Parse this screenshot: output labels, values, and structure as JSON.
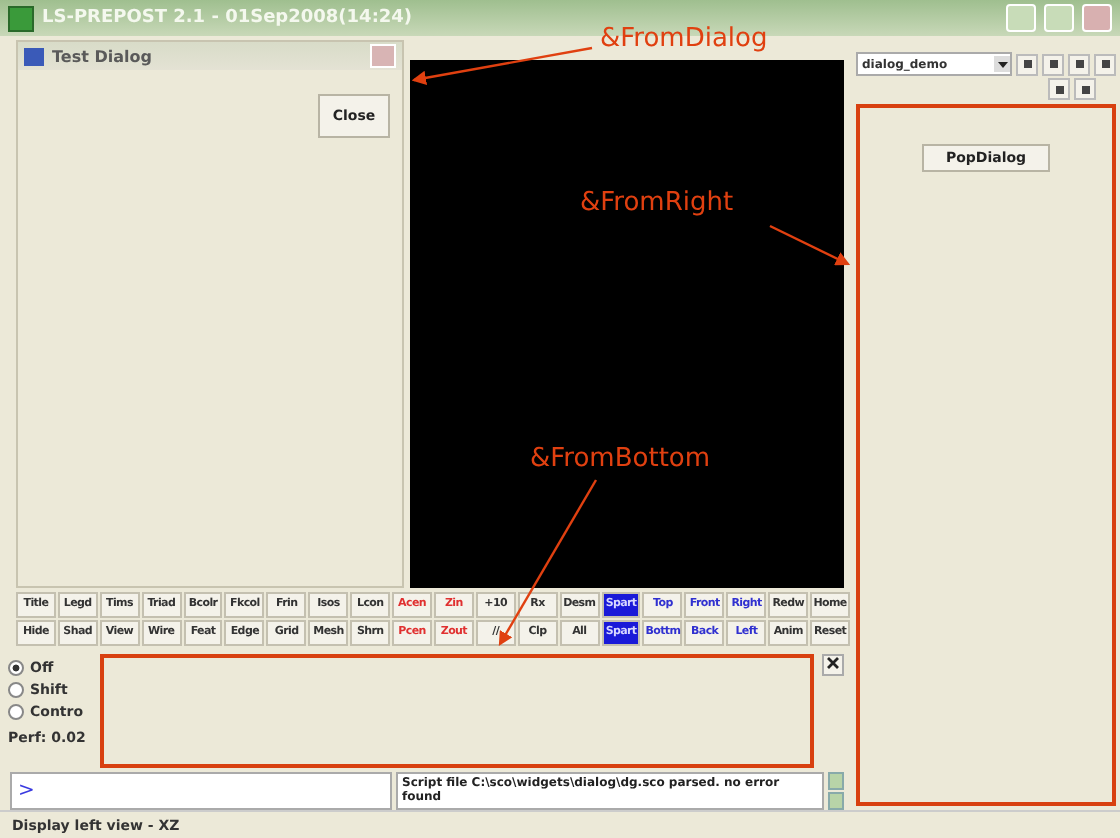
{
  "window": {
    "title": "LS-PREPOST 2.1 - 01Sep2008(14:24)"
  },
  "dialog": {
    "title": "Test Dialog",
    "button": "Close"
  },
  "right_panel": {
    "select": "dialog_demo",
    "button": "PopDialog"
  },
  "toolbar": {
    "rows": [
      [
        {
          "label": "Title",
          "kind": "plain",
          "selected": false
        },
        {
          "label": "Legd",
          "kind": "plain",
          "selected": false
        },
        {
          "label": "Tims",
          "kind": "plain",
          "selected": false
        },
        {
          "label": "Triad",
          "kind": "plain",
          "selected": false
        },
        {
          "label": "Bcolr",
          "kind": "plain",
          "selected": false
        },
        {
          "label": "Fkcol",
          "kind": "plain",
          "selected": false
        },
        {
          "label": "Frin",
          "kind": "plain",
          "selected": false
        },
        {
          "label": "Isos",
          "kind": "plain",
          "selected": false
        },
        {
          "label": "Lcon",
          "kind": "plain",
          "selected": false
        },
        {
          "label": "Acen",
          "kind": "red",
          "selected": false
        },
        {
          "label": "Zin",
          "kind": "red",
          "selected": false
        },
        {
          "label": "+10",
          "kind": "plain",
          "selected": false
        },
        {
          "label": "Rx",
          "kind": "plain",
          "selected": false
        },
        {
          "label": "Desm",
          "kind": "plain",
          "selected": false
        },
        {
          "label": "Spart",
          "kind": "blue",
          "selected": true
        },
        {
          "label": "Top",
          "kind": "blue",
          "selected": false
        },
        {
          "label": "Front",
          "kind": "blue",
          "selected": false
        },
        {
          "label": "Right",
          "kind": "blue",
          "selected": false
        },
        {
          "label": "Redw",
          "kind": "plain",
          "selected": false
        },
        {
          "label": "Home",
          "kind": "plain",
          "selected": false
        }
      ],
      [
        {
          "label": "Hide",
          "kind": "plain",
          "selected": false
        },
        {
          "label": "Shad",
          "kind": "plain",
          "selected": false
        },
        {
          "label": "View",
          "kind": "plain",
          "selected": false
        },
        {
          "label": "Wire",
          "kind": "plain",
          "selected": false
        },
        {
          "label": "Feat",
          "kind": "plain",
          "selected": false
        },
        {
          "label": "Edge",
          "kind": "plain",
          "selected": false
        },
        {
          "label": "Grid",
          "kind": "plain",
          "selected": false
        },
        {
          "label": "Mesh",
          "kind": "plain",
          "selected": false
        },
        {
          "label": "Shrn",
          "kind": "plain",
          "selected": false
        },
        {
          "label": "Pcen",
          "kind": "red",
          "selected": false
        },
        {
          "label": "Zout",
          "kind": "red",
          "selected": false
        },
        {
          "label": "//",
          "kind": "plain",
          "selected": false
        },
        {
          "label": "Clp",
          "kind": "plain",
          "selected": false
        },
        {
          "label": "All",
          "kind": "plain",
          "selected": false
        },
        {
          "label": "Spart",
          "kind": "blue",
          "selected": true
        },
        {
          "label": "Bottm",
          "kind": "blue",
          "selected": false
        },
        {
          "label": "Back",
          "kind": "blue",
          "selected": false
        },
        {
          "label": "Left",
          "kind": "blue",
          "selected": false
        },
        {
          "label": "Anim",
          "kind": "plain",
          "selected": false
        },
        {
          "label": "Reset",
          "kind": "plain",
          "selected": false
        }
      ]
    ]
  },
  "pick_mode": [
    {
      "label": "Off",
      "selected": true
    },
    {
      "label": "Shift",
      "selected": false
    },
    {
      "label": "Contro",
      "selected": false
    }
  ],
  "perf": "Perf: 0.02",
  "command": {
    "prompt": ">",
    "message": "Script file C:\\sco\\widgets\\dialog\\dg.sco parsed. no error found"
  },
  "status_bar": "Display left view - XZ",
  "annotations": [
    "&FromDialog",
    "&FromRight",
    "&FromBottom"
  ]
}
